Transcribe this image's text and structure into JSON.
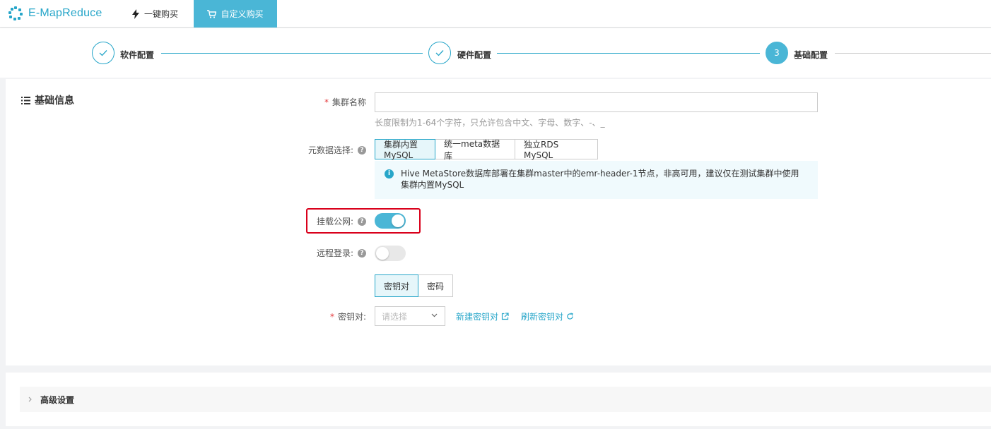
{
  "header": {
    "logo_text": "E-MapReduce",
    "tabs": [
      {
        "label": "一键购买",
        "icon": "lightning-icon"
      },
      {
        "label": "自定义购买",
        "icon": "cart-icon"
      }
    ]
  },
  "steps": [
    {
      "label": "软件配置",
      "status": "done"
    },
    {
      "label": "硬件配置",
      "status": "done"
    },
    {
      "number": "3",
      "label": "基础配置",
      "status": "active"
    }
  ],
  "section": {
    "title": "基础信息",
    "icon": "list-icon"
  },
  "form": {
    "cluster_name": {
      "label": "集群名称",
      "required_mark": "*",
      "value": "",
      "hint": "长度限制为1-64个字符，只允许包含中文、字母、数字、-、_"
    },
    "metadata": {
      "label": "元数据选择:",
      "help": "?",
      "options": [
        "集群内置MySQL",
        "统一meta数据库",
        "独立RDS MySQL"
      ],
      "selected": "集群内置MySQL",
      "info_icon": "i",
      "info_line1": "Hive MetaStore数据库部署在集群master中的emr-header-1节点，非高可用，建议仅在测试集群中使用",
      "info_line2": "集群内置MySQL"
    },
    "public_ip": {
      "label": "挂载公网:",
      "help": "?",
      "enabled": true
    },
    "remote_login": {
      "label": "远程登录:",
      "help": "?",
      "enabled": false
    },
    "auth_type": {
      "options": [
        "密钥对",
        "密码"
      ],
      "selected": "密钥对"
    },
    "key_pair": {
      "label": "密钥对:",
      "required_mark": "*",
      "placeholder": "请选择",
      "create_link": "新建密钥对",
      "refresh_link": "刷新密钥对"
    }
  },
  "advanced": {
    "label": "高级设置"
  },
  "colors": {
    "accent": "#27a6c9",
    "highlight": "#d9001b"
  }
}
